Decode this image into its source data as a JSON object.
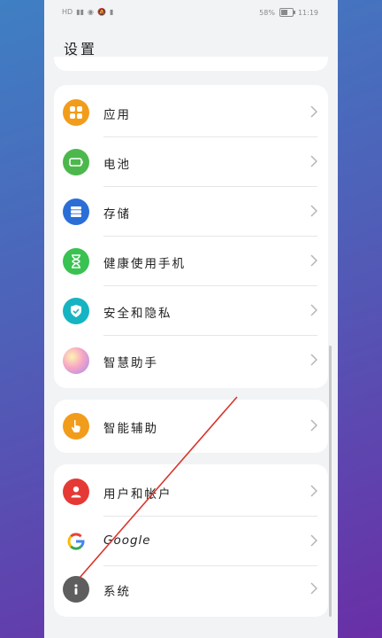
{
  "status_bar": {
    "left_icons": [
      "hd-icon",
      "signal-icon",
      "eye-icon",
      "mute-icon",
      "sim-icon"
    ],
    "battery_percent": "58%",
    "time": "11:19"
  },
  "page": {
    "title": "设置"
  },
  "groups": [
    {
      "items": [
        {
          "label": "应用",
          "icon": "apps-icon",
          "color": "#f29c1b"
        },
        {
          "label": "电池",
          "icon": "battery-icon",
          "color": "#4cb84c"
        },
        {
          "label": "存储",
          "icon": "storage-icon",
          "color": "#2b6fd6"
        },
        {
          "label": "健康使用手机",
          "icon": "hourglass-icon",
          "color": "#39c251"
        },
        {
          "label": "安全和隐私",
          "icon": "shield-icon",
          "color": "#16b4c2"
        },
        {
          "label": "智慧助手",
          "icon": "assistant-icon",
          "color": "#e98bb5"
        }
      ]
    },
    {
      "items": [
        {
          "label": "智能辅助",
          "icon": "hand-icon",
          "color": "#f29c1b"
        }
      ]
    },
    {
      "items": [
        {
          "label": "用户和帐户",
          "icon": "user-icon",
          "color": "#e53935"
        },
        {
          "label": "Google",
          "icon": "google-icon",
          "color": "#ffffff"
        },
        {
          "label": "系统",
          "icon": "info-icon",
          "color": "#5e5e5e"
        }
      ]
    }
  ]
}
